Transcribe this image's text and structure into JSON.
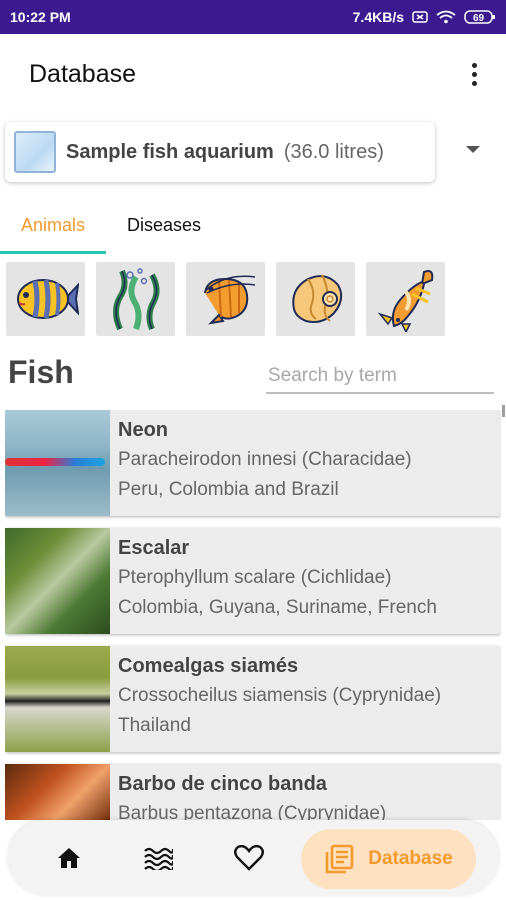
{
  "status_bar": {
    "time": "10:22 PM",
    "network_speed": "7.4KB/s",
    "battery": "69"
  },
  "appbar": {
    "title": "Database",
    "menu_icon": "more-vert-icon"
  },
  "tank_selector": {
    "name": "Sample fish aquarium",
    "volume": "(36.0 litres)",
    "icon": "aquarium-icon"
  },
  "tabs": [
    {
      "label": "Animals",
      "active": true
    },
    {
      "label": "Diseases",
      "active": false
    }
  ],
  "categories": [
    {
      "icon": "tropical-fish-icon",
      "selected": true
    },
    {
      "icon": "aquatic-plants-icon",
      "selected": false
    },
    {
      "icon": "shrimp-icon",
      "selected": false
    },
    {
      "icon": "snail-icon",
      "selected": false
    },
    {
      "icon": "koi-fish-icon",
      "selected": false
    }
  ],
  "section": {
    "title": "Fish"
  },
  "search": {
    "placeholder": "Search by term",
    "value": ""
  },
  "fish_list": [
    {
      "name": "Neon",
      "scientific": "Paracheirodon innesi (Characidae)",
      "origin": "Peru, Colombia and Brazil"
    },
    {
      "name": "Escalar",
      "scientific": "Pterophyllum scalare (Cichlidae)",
      "origin": "Colombia, Guyana, Suriname, French"
    },
    {
      "name": "Comealgas siamés",
      "scientific": "Crossocheilus siamensis (Cyprynidae)",
      "origin": "Thailand"
    },
    {
      "name": "Barbo de cinco banda",
      "scientific": "Barbus pentazona (Cyprynidae)",
      "origin": ""
    }
  ],
  "bottom_nav": {
    "items": [
      {
        "icon": "home-icon"
      },
      {
        "icon": "water-icon"
      },
      {
        "icon": "heart-icon"
      }
    ],
    "active": {
      "icon": "database-icon",
      "label": "Database"
    }
  },
  "colors": {
    "accent": "#f29a2e",
    "tab_indicator": "#27c3b0",
    "status_bar": "#3b1a8f",
    "active_nav_bg": "#fde1c1"
  }
}
